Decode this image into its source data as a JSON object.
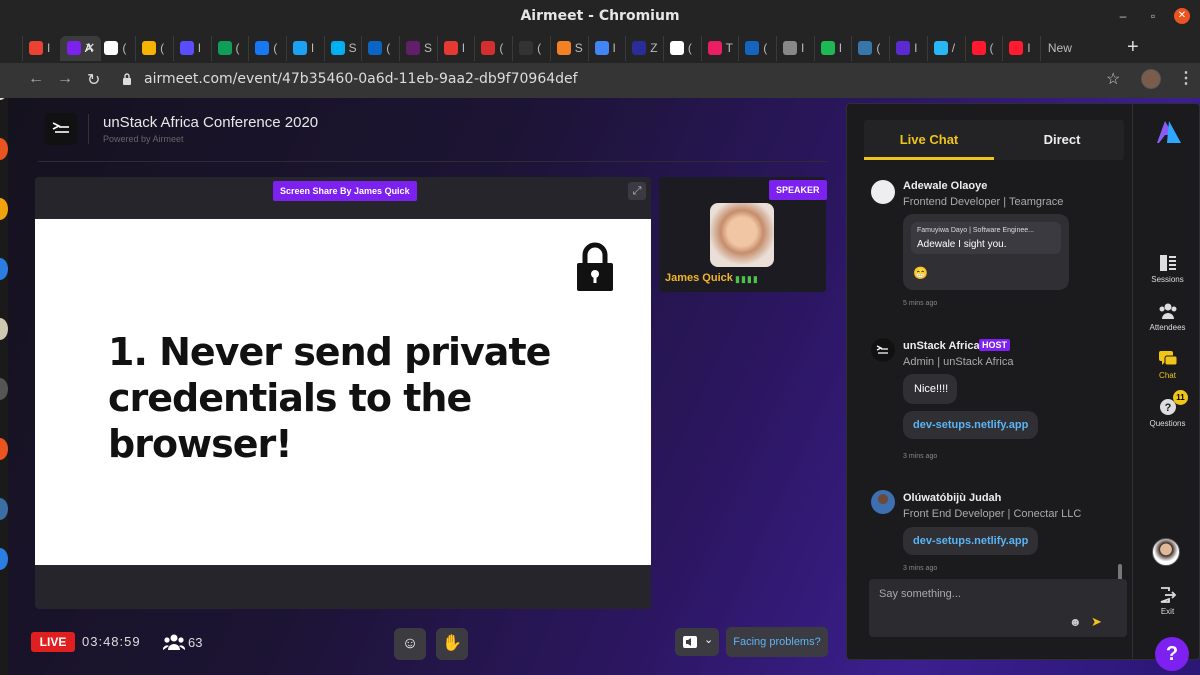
{
  "window": {
    "title": "Airmeet - Chromium"
  },
  "tabs": [
    {
      "label": "I",
      "color": "#ea4335"
    },
    {
      "label": "A",
      "color": "#7c21f0",
      "active": true
    },
    {
      "label": "(",
      "color": "#ffffff"
    },
    {
      "label": "(",
      "color": "#f4b400"
    },
    {
      "label": "I",
      "color": "#5b4cff"
    },
    {
      "label": "(",
      "color": "#0f9d58"
    },
    {
      "label": "(",
      "color": "#1877f2"
    },
    {
      "label": "I",
      "color": "#1da1f2"
    },
    {
      "label": "S",
      "color": "#00aff0"
    },
    {
      "label": "(",
      "color": "#0a66c2"
    },
    {
      "label": "S",
      "color": "#611f69"
    },
    {
      "label": "I",
      "color": "#e53935"
    },
    {
      "label": "(",
      "color": "#d32f2f"
    },
    {
      "label": "(",
      "color": "#333333"
    },
    {
      "label": "S",
      "color": "#f48024"
    },
    {
      "label": "I",
      "color": "#4285f4"
    },
    {
      "label": "Z",
      "color": "#2b2b99"
    },
    {
      "label": "(",
      "color": "#ffffff"
    },
    {
      "label": "T",
      "color": "#e91e63"
    },
    {
      "label": "(",
      "color": "#1565c0"
    },
    {
      "label": "I",
      "color": "#888888"
    },
    {
      "label": "I",
      "color": "#1db954"
    },
    {
      "label": "(",
      "color": "#3776ab"
    },
    {
      "label": "I",
      "color": "#5b2bd1"
    },
    {
      "label": "/",
      "color": "#29b6f6"
    },
    {
      "label": "(",
      "color": "#ff1b2d"
    },
    {
      "label": "I",
      "color": "#ff1b2d"
    },
    {
      "label": "New",
      "color": ""
    }
  ],
  "address": {
    "url": "airmeet.com/event/47b35460-0a6d-11eb-9aa2-db9f70964def"
  },
  "header": {
    "event_title": "unStack Africa Conference 2020",
    "powered_by": "Powered by Airmeet"
  },
  "stage": {
    "screen_share_label": "Screen Share By James Quick",
    "slide_text": "1. Never send private credentials to the browser!"
  },
  "speaker": {
    "badge": "SPEAKER",
    "name": "James Quick"
  },
  "controls": {
    "live": "LIVE",
    "timer": "03:48:59",
    "attendee_count": "63",
    "facing_problems": "Facing problems?"
  },
  "panel": {
    "tab_live": "Live Chat",
    "tab_direct": "Direct",
    "messages": [
      {
        "name": "Adewale Olaoye",
        "title": "Frontend Developer | Teamgrace",
        "quote_author": "Famuyiwa Dayo | Software Enginee...",
        "quote_text": "Adewale I sight you.",
        "emoji": "😁",
        "time": "5 mins ago"
      },
      {
        "name": "unStack Africa",
        "badge": "HOST",
        "title": "Admin | unStack Africa",
        "text": "Nice!!!!",
        "link": "dev-setups.netlify.app",
        "time": "3 mins ago"
      },
      {
        "name": "Olúwatóbijù Judah",
        "title": "Front End Developer | Conectar LLC",
        "link": "dev-setups.netlify.app",
        "time": "3 mins ago"
      }
    ],
    "input_placeholder": "Say something..."
  },
  "rail": {
    "sessions": "Sessions",
    "attendees": "Attendees",
    "chat": "Chat",
    "questions": "Questions",
    "questions_badge": "11",
    "exit": "Exit"
  },
  "colors": {
    "accent": "#7c21f0",
    "active_tab": "#f0c419",
    "link": "#5bb5f4",
    "live": "#e02020"
  }
}
